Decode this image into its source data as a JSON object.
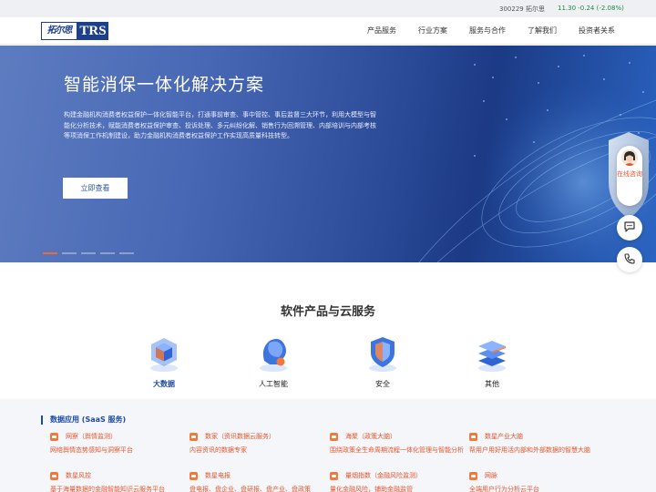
{
  "topbar": {
    "stock_name": "300229 拓尔思",
    "stock_quote": "11.30 -0.24 (-2.08%)"
  },
  "logo": {
    "cn": "拓尔思",
    "en": "TRS"
  },
  "nav": [
    {
      "label": "产品服务"
    },
    {
      "label": "行业方案"
    },
    {
      "label": "服务与合作"
    },
    {
      "label": "了解我们"
    },
    {
      "label": "投资者关系"
    }
  ],
  "hero": {
    "title": "智能消保一体化解决方案",
    "description": "构建金融机构消费者权益保护一体化智能平台，打通事前审查、事中管控、事后监督三大环节，利用大模型与智能化分析技术，赋能消费者权益保护审查、投诉处理、多元纠纷化解、销售行为回溯管理、内部培训与内部考核等项消保工作机制建设，助力金融机构消费者权益保护工作实现高质量科技转型。",
    "button_label": "立即查看",
    "slide_count": 5,
    "active_slide": 1
  },
  "float": {
    "consult_label": "在线咨询",
    "chat_icon": "chat-bubble-icon",
    "phone_icon": "phone-icon"
  },
  "products": {
    "title": "软件产品与云服务",
    "categories": [
      {
        "label": "大数据",
        "icon": "big-data-cube-icon",
        "active": true
      },
      {
        "label": "人工智能",
        "icon": "ai-head-icon",
        "active": false
      },
      {
        "label": "安全",
        "icon": "security-shield-icon",
        "active": false
      },
      {
        "label": "其他",
        "icon": "layers-stack-icon",
        "active": false
      }
    ]
  },
  "panel": {
    "heading": "数据应用 (SaaS 服务)",
    "items": [
      {
        "name": "网察（舆情监测）",
        "desc": "网络舆情态势感知与洞察平台"
      },
      {
        "name": "数家（资讯数据云服务）",
        "desc": "内容资讯的数据专家"
      },
      {
        "name": "海聚（政策大脑）",
        "desc": "围绕政策全生命周期流程一体化管理与智能分析"
      },
      {
        "name": "数星产业大脑",
        "desc": "帮用户用好用活内部和外部数据的智慧大脑"
      },
      {
        "name": "数星风控",
        "desc": "基于海量数据的金融智能知识云服务平台"
      },
      {
        "name": "数星电报",
        "desc": "盘电报、盘企业、盘研报、盘产业、盘政策"
      },
      {
        "name": "量烟指数（金融风险监测）",
        "desc": "量化金融风险，铺助金融监管"
      },
      {
        "name": "网脉",
        "desc": "全端用户行为分析云平台"
      }
    ]
  },
  "colors": {
    "brand": "#1e3f8a",
    "accent": "#e8552c",
    "active_dot": "#f06a35"
  }
}
